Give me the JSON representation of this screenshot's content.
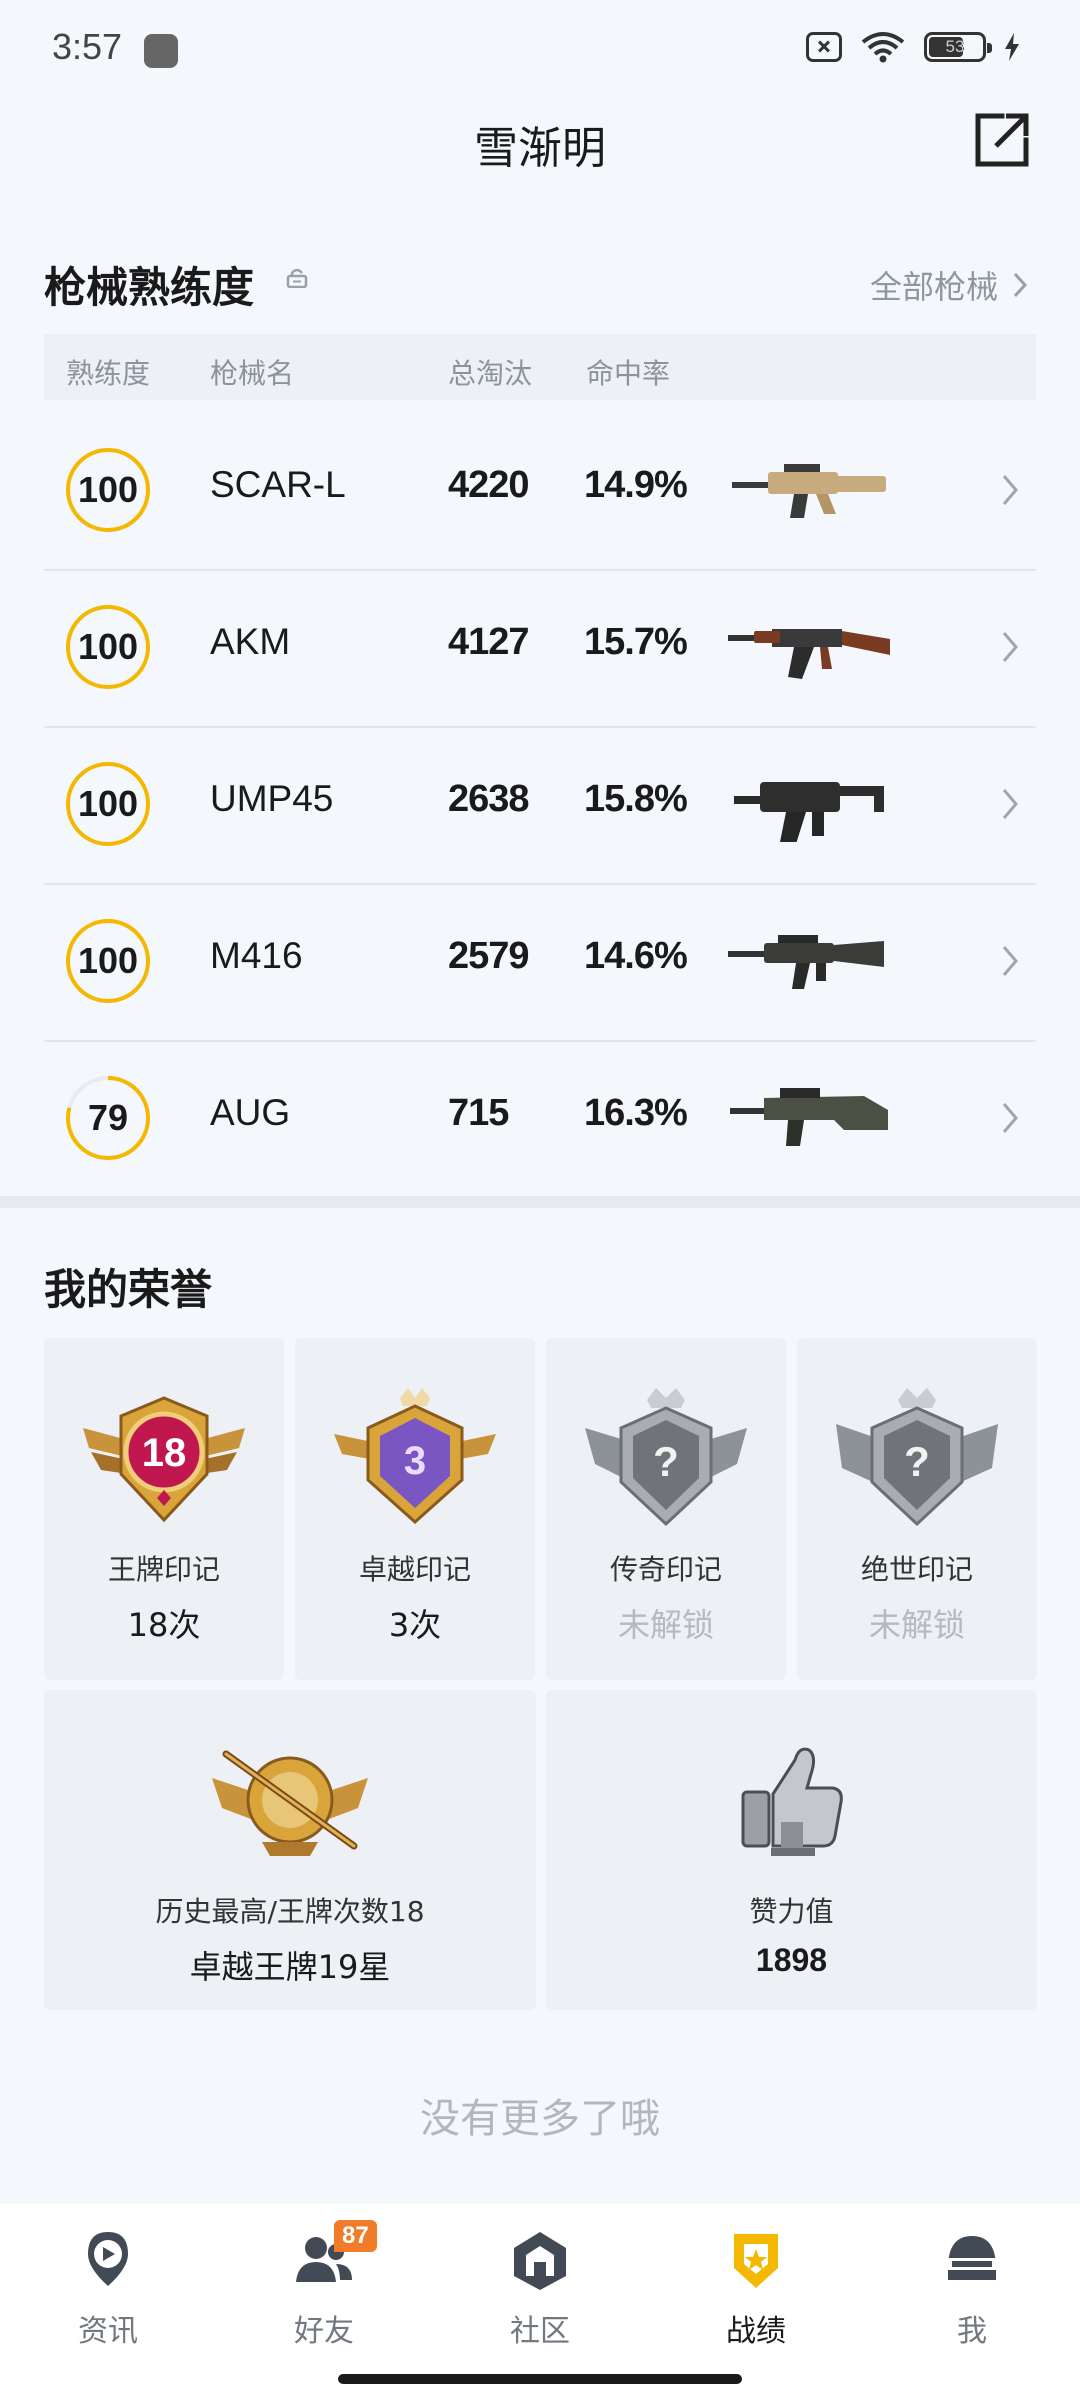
{
  "status_bar": {
    "time": "3:57",
    "battery": "53"
  },
  "header": {
    "title": "雪渐明"
  },
  "mastery": {
    "title": "枪械熟练度",
    "all_link": "全部枪械",
    "columns": [
      "熟练度",
      "枪械名",
      "总淘汰",
      "命中率"
    ],
    "rows": [
      {
        "level": "100",
        "progress": 1.0,
        "name": "SCAR-L",
        "kills": "4220",
        "hit_rate": "14.9%"
      },
      {
        "level": "100",
        "progress": 1.0,
        "name": "AKM",
        "kills": "4127",
        "hit_rate": "15.7%"
      },
      {
        "level": "100",
        "progress": 1.0,
        "name": "UMP45",
        "kills": "2638",
        "hit_rate": "15.8%"
      },
      {
        "level": "100",
        "progress": 1.0,
        "name": "M416",
        "kills": "2579",
        "hit_rate": "14.6%"
      },
      {
        "level": "79",
        "progress": 0.79,
        "name": "AUG",
        "kills": "715",
        "hit_rate": "16.3%"
      }
    ]
  },
  "honors": {
    "title": "我的荣誉",
    "marks": [
      {
        "label": "王牌印记",
        "value": "18次",
        "badge_text": "18"
      },
      {
        "label": "卓越印记",
        "value": "3次",
        "badge_text": "3"
      },
      {
        "label": "传奇印记",
        "value": "未解锁",
        "badge_text": "?"
      },
      {
        "label": "绝世印记",
        "value": "未解锁",
        "badge_text": "?"
      }
    ],
    "history": {
      "label": "历史最高/王牌次数18",
      "value": "卓越王牌19星"
    },
    "likes": {
      "label": "赞力值",
      "value": "1898"
    }
  },
  "footer_text": "没有更多了哦",
  "nav": {
    "items": [
      {
        "label": "资讯"
      },
      {
        "label": "好友",
        "badge": "87"
      },
      {
        "label": "社区"
      },
      {
        "label": "战绩"
      },
      {
        "label": "我"
      }
    ]
  },
  "colors": {
    "accent": "#f5b800",
    "ring_track": "#e8ebef",
    "gold": "#d9a43a"
  }
}
